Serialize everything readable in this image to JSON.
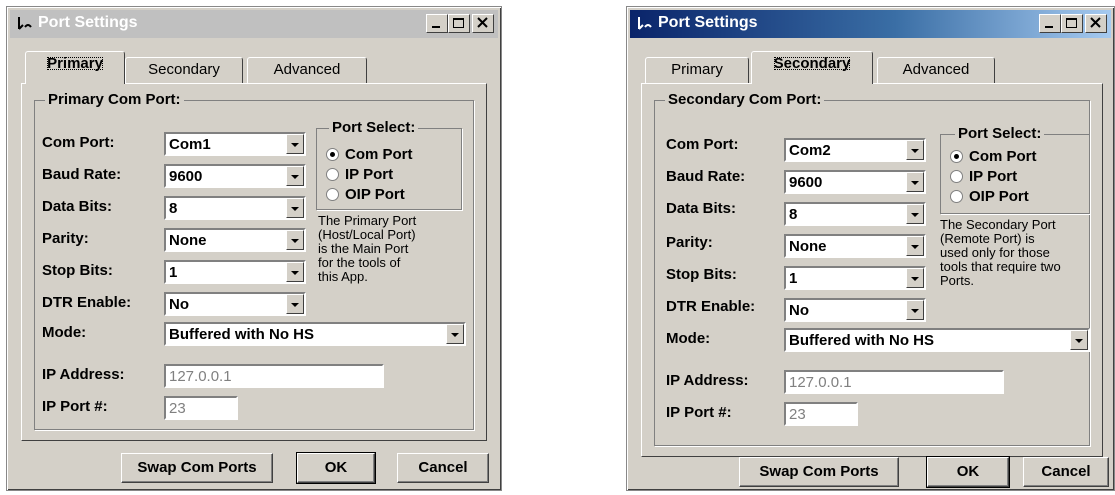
{
  "left": {
    "title": "Port Settings",
    "tabs": [
      "Primary",
      "Secondary",
      "Advanced"
    ],
    "selected_tab": "Primary",
    "group_title": "Primary Com Port:",
    "fields": {
      "com_port": {
        "label": "Com Port:",
        "value": "Com1"
      },
      "baud_rate": {
        "label": "Baud Rate:",
        "value": "9600"
      },
      "data_bits": {
        "label": "Data Bits:",
        "value": "8"
      },
      "parity": {
        "label": "Parity:",
        "value": "None"
      },
      "stop_bits": {
        "label": "Stop Bits:",
        "value": "1"
      },
      "dtr_enable": {
        "label": "DTR Enable:",
        "value": "No"
      },
      "mode": {
        "label": "Mode:",
        "value": "Buffered with No HS"
      },
      "ip_address": {
        "label": "IP Address:",
        "value": "127.0.0.1"
      },
      "ip_port": {
        "label": "IP Port #:",
        "value": "23"
      }
    },
    "port_select": {
      "title": "Port Select:",
      "options": [
        "Com Port",
        "IP Port",
        "OIP Port"
      ],
      "selected": "Com Port"
    },
    "note": [
      "The Primary Port",
      "(Host/Local Port)",
      "is the Main Port",
      "for the tools of",
      "this App."
    ],
    "buttons": {
      "swap": "Swap Com Ports",
      "ok": "OK",
      "cancel": "Cancel"
    }
  },
  "right": {
    "title": "Port Settings",
    "tabs": [
      "Primary",
      "Secondary",
      "Advanced"
    ],
    "selected_tab": "Secondary",
    "group_title": "Secondary Com Port:",
    "fields": {
      "com_port": {
        "label": "Com Port:",
        "value": "Com2"
      },
      "baud_rate": {
        "label": "Baud Rate:",
        "value": "9600"
      },
      "data_bits": {
        "label": "Data Bits:",
        "value": "8"
      },
      "parity": {
        "label": "Parity:",
        "value": "None"
      },
      "stop_bits": {
        "label": "Stop Bits:",
        "value": "1"
      },
      "dtr_enable": {
        "label": "DTR Enable:",
        "value": "No"
      },
      "mode": {
        "label": "Mode:",
        "value": "Buffered with No HS"
      },
      "ip_address": {
        "label": "IP Address:",
        "value": "127.0.0.1"
      },
      "ip_port": {
        "label": "IP Port #:",
        "value": "23"
      }
    },
    "port_select": {
      "title": "Port Select:",
      "options": [
        "Com Port",
        "IP Port",
        "OIP Port"
      ],
      "selected": "Com Port"
    },
    "note": [
      "The Secondary Port",
      "(Remote Port) is",
      "used only for those",
      "tools that require two",
      "Ports."
    ],
    "buttons": {
      "swap": "Swap Com Ports",
      "ok": "OK",
      "cancel": "Cancel"
    }
  }
}
